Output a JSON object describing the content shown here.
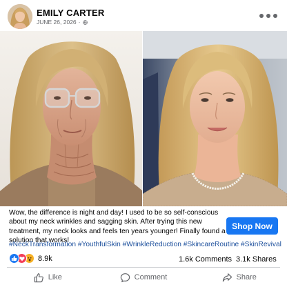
{
  "post": {
    "author": "EMILY CARTER",
    "date": "JUNE 26, 2026",
    "separator": "·",
    "caption": "Wow, the difference is night and day! I used to be so self-conscious about my neck wrinkles and sagging skin. After trying this new treatment, my neck looks and feels ten years younger! Finally found a solution that works!",
    "hashtags": "#NeckTransformation #YouthfulSkin #WrinkleReduction #SkincareRoutine #SkinRevival",
    "cta_label": "Shop Now"
  },
  "stats": {
    "reaction_icons": [
      "like-icon",
      "love-icon",
      "wow-icon"
    ],
    "reaction_count": "8.9k",
    "comments": "1.6k Comments",
    "shares": "3.1k Shares"
  },
  "actions": {
    "like": "Like",
    "comment": "Comment",
    "share": "Share"
  },
  "colors": {
    "accent": "#1877f2",
    "hashtag": "#1c4f9c",
    "muted": "#65676b",
    "love": "#f33e58",
    "wow": "#f7b125"
  }
}
